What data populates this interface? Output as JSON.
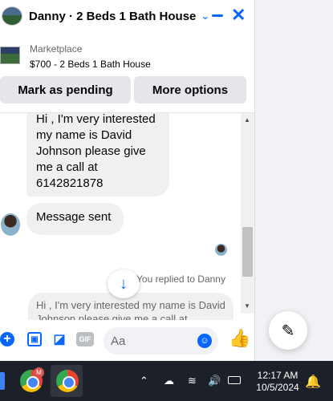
{
  "header": {
    "title": "Danny · 2 Beds 1 Bath House",
    "chevron": "⌄",
    "close": "✕"
  },
  "marketplace": {
    "label": "Marketplace",
    "detail": "$700 - 2 Beds 1 Bath House"
  },
  "actions": {
    "pending": "Mark as pending",
    "more": "More options"
  },
  "messages": {
    "incoming_1": "Hi , I'm very interested my name is David Johnson please give me a call at 6142821878",
    "incoming_2": "Message sent",
    "replied_label": "You replied to Danny",
    "quoted": "Hi , I'm very interested my name is David Johnson please give me a call at..."
  },
  "composer": {
    "placeholder": "Aa",
    "gif": "GIF"
  },
  "taskbar": {
    "time": "12:17 AM",
    "date": "10/5/2024",
    "badge": "M"
  },
  "colors": {
    "accent": "#0866ff",
    "bubble": "#f0f0f0",
    "taskbar": "#1c2028"
  }
}
